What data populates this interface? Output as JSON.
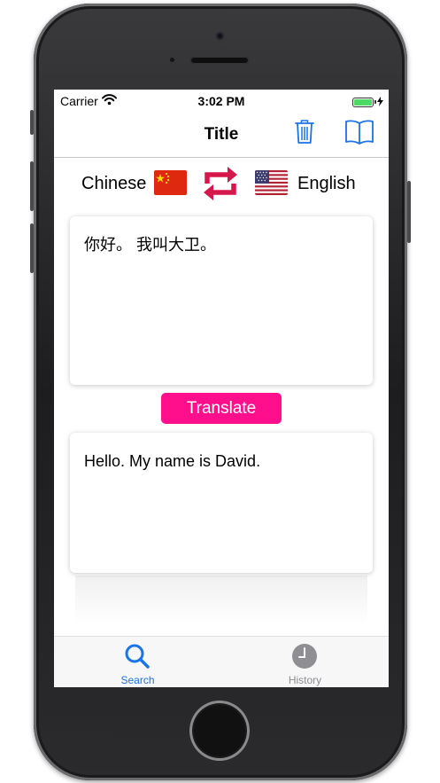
{
  "status_bar": {
    "carrier": "Carrier",
    "time": "3:02 PM"
  },
  "nav": {
    "title": "Title"
  },
  "languages": {
    "source": "Chinese",
    "target": "English"
  },
  "input": {
    "text": "你好。 我叫大卫。"
  },
  "actions": {
    "translate_label": "Translate"
  },
  "output": {
    "text": "Hello. My name is David."
  },
  "tabs": [
    {
      "label": "Search",
      "icon": "search-icon",
      "selected": true
    },
    {
      "label": "History",
      "icon": "clock-icon",
      "selected": false
    }
  ],
  "colors": {
    "accent_blue": "#1a73e8",
    "translate_pink": "#ff0f8c",
    "swap_crimson": "#d6174c",
    "inactive_gray": "#8e8e93",
    "battery_green": "#4cd964"
  }
}
